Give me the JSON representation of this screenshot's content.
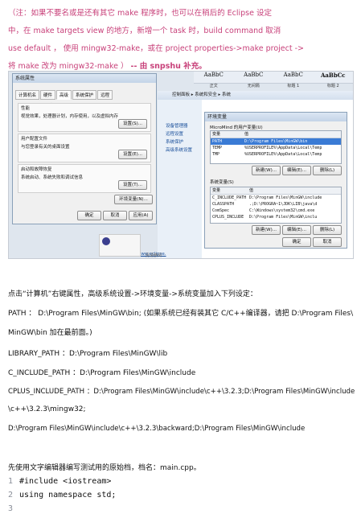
{
  "notes": [
    "（注：如果不要名或是还有其它 make 程序时，也可以在稍后的 Eclipse 设定",
    "中，在 make targets view 的地方，新增一个 task 时，build command 取消",
    "use default ， 使用 mingw32-make，或在 project properties->make project ->",
    "将 make 改为 mingw32-make ）",
    "-- 由 snpshu 补充。"
  ],
  "screenshot": {
    "ribbon_samples": [
      "AaBbC",
      "AaBbC",
      "AaBbC",
      "AaBbCc"
    ],
    "ribbon_labels": [
      "正文",
      "无间隔",
      "标题 1",
      "标题 2"
    ],
    "sysprops_title": "系统属性",
    "sysprops_tabs": [
      "计算机名",
      "硬件",
      "高级",
      "系统保护",
      "远程"
    ],
    "admin_note": "要进行大多数更改，您必须作为管理员登录。",
    "groups": [
      {
        "title": "性能",
        "desc": "视觉效果，处理器计划，内存使用，以及虚拟内存",
        "button": "设置(S)..."
      },
      {
        "title": "用户配置文件",
        "desc": "与您登录有关的桌面设置",
        "button": "设置(E)..."
      },
      {
        "title": "启动和故障恢复",
        "desc": "系统启动、系统失败和调试信息",
        "button": "设置(T)..."
      }
    ],
    "env_button": "环境变量(N)...",
    "ok": "确定",
    "cancel": "取消",
    "apply": "应用(A)",
    "control_panel_path": "控制面板 ▸ 系统和安全 ▸ 系统",
    "side_items": [
      "设备管理器",
      "远程设置",
      "系统保护",
      "高级系统设置"
    ],
    "env_title": "环境变量",
    "user_section": "MicroMind 的用户变量(U)",
    "var_header": [
      "变量",
      "值"
    ],
    "user_vars": [
      {
        "name": "PATH",
        "value": "D:\\Program Files\\MinGW\\bin"
      },
      {
        "name": "TEMP",
        "value": "%USERPROFILE%\\AppData\\Local\\Temp"
      },
      {
        "name": "TMP",
        "value": "%USERPROFILE%\\AppData\\Local\\Temp"
      }
    ],
    "sys_section": "系统变量(S)",
    "sys_vars": [
      {
        "name": "C_INCLUDE_PATH",
        "value": "D:\\Program Files\\MinGW\\include"
      },
      {
        "name": "CLASSPATH",
        "value": ".;D:\\PROGRA~1\\JDK\\LIB\\java\\d"
      },
      {
        "name": "ComSpec",
        "value": "C:\\Windows\\system32\\cmd.exe"
      },
      {
        "name": "CPLUS_INCLUDE",
        "value": "D:\\Program Files\\MinGW\\inclu"
      }
    ],
    "env_new": "新建(W)...",
    "env_edit": "编辑(E)...",
    "env_delete": "删除(L)",
    "link_text": "http://www.eclipse.",
    "footer_label": "另请参阅"
  },
  "paragraphs": {
    "p1": "点击“计算机”右键属性，高级系统设置->环境变量->系统变量加入下列设定：",
    "path_line1": "PATH ： D:\\Program Files\\MinGW\\bin; (如果系统已经有装其它 C/C++编译器，请把 D:\\Program Files\\",
    "path_line2": "MinGW\\bin 加在最前面。)",
    "library_path": "LIBRARY_PATH ：D:\\Program Files\\MinGW\\lib",
    "c_include": "C_INCLUDE_PATH ：D:\\Program Files\\MinGW\\include",
    "cplus_line1": "CPLUS_INCLUDE_PATH ：D:\\Program Files\\MinGW\\include\\c++\\3.2.3;D:\\Program Files\\MinGW\\include",
    "cplus_line2": "\\c++\\3.2.3\\mingw32;",
    "cplus_line3": "D:\\Program Files\\MinGW\\include\\c++\\3.2.3\\backward;D:\\Program Files\\MinGW\\include",
    "p_edit": "先使用文字编辑器编写测试用的原始档，档名：main.cpp。"
  },
  "code_lines": [
    {
      "n": "1",
      "text": "#include <iostream>"
    },
    {
      "n": "2",
      "text": "using namespace std;"
    },
    {
      "n": "3",
      "text": ""
    }
  ]
}
